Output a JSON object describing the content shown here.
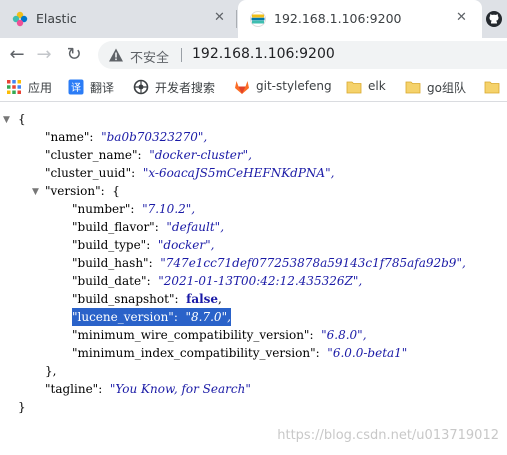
{
  "browser": {
    "tabs": [
      {
        "title": "Elastic",
        "icon": "elastic-icon"
      },
      {
        "title": "192.168.1.106:9200",
        "icon": "elastic-icon"
      }
    ],
    "close_glyph": "✕",
    "omnibox": {
      "security_label": "不安全",
      "url": "192.168.1.106:9200"
    },
    "nav": {
      "back": "←",
      "forward": "→",
      "reload": "↻"
    },
    "bookmarks": [
      {
        "label": "应用",
        "icon": "apps-grid-icon"
      },
      {
        "label": "翻译",
        "icon": "translate-icon"
      },
      {
        "label": "开发者搜索",
        "icon": "dev-search-icon"
      },
      {
        "label": "git-stylefeng",
        "icon": "gitlab-icon"
      },
      {
        "label": "elk",
        "icon": "folder-icon"
      },
      {
        "label": "go组队",
        "icon": "folder-icon"
      }
    ]
  },
  "json_view": {
    "toggle_open": "▼",
    "lines": {
      "open_brace": "{",
      "name_key": "\"name\":",
      "name_val": "\"ba0b70323270\",",
      "cluster_name_key": "\"cluster_name\":",
      "cluster_name_val": "\"docker-cluster\",",
      "cluster_uuid_key": "\"cluster_uuid\":",
      "cluster_uuid_val": "\"x-6oacaJS5mCeHEFNKdPNA\",",
      "version_key": "\"version\":",
      "version_open": "{",
      "number_key": "\"number\":",
      "number_val": "\"7.10.2\",",
      "build_flavor_key": "\"build_flavor\":",
      "build_flavor_val": "\"default\",",
      "build_type_key": "\"build_type\":",
      "build_type_val": "\"docker\",",
      "build_hash_key": "\"build_hash\":",
      "build_hash_val": "\"747e1cc71def077253878a59143c1f785afa92b9\",",
      "build_date_key": "\"build_date\":",
      "build_date_val": "\"2021-01-13T00:42:12.435326Z\",",
      "build_snapshot_key": "\"build_snapshot\":",
      "build_snapshot_val": "false",
      "build_snapshot_comma": ",",
      "lucene_version_key": "\"lucene_version\":",
      "lucene_version_val": "\"8.7.0\",",
      "min_wire_key": "\"minimum_wire_compatibility_version\":",
      "min_wire_val": "\"6.8.0\",",
      "min_index_key": "\"minimum_index_compatibility_version\":",
      "min_index_val": "\"6.0.0-beta1\"",
      "version_close": "},",
      "tagline_key": "\"tagline\":",
      "tagline_val": "\"You Know, for Search\"",
      "close_brace": "}"
    }
  },
  "watermark": "https://blog.csdn.net/u013719012"
}
